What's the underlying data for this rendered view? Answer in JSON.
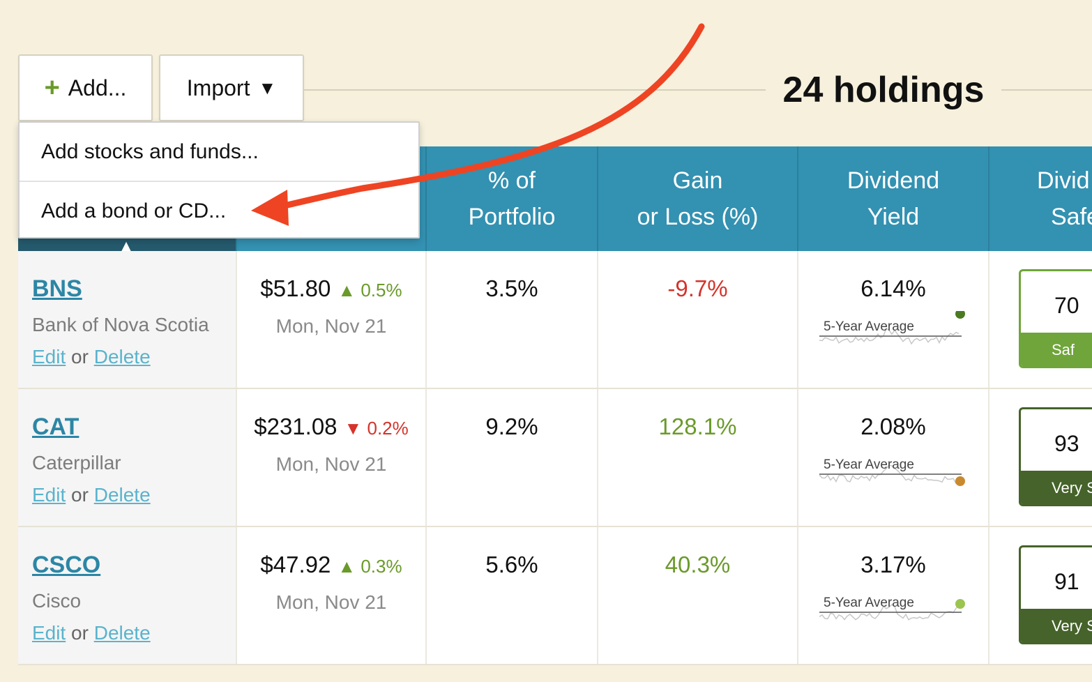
{
  "toolbar": {
    "add_icon": "plus-icon",
    "add_label": "Add...",
    "import_label": "Import",
    "import_icon": "caret-down-icon"
  },
  "holdings_title": "24 holdings",
  "add_menu": {
    "items": [
      {
        "label": "Add stocks and funds..."
      },
      {
        "label": "Add a bond or CD..."
      }
    ]
  },
  "table": {
    "headers": [
      {
        "line1": "",
        "line2": ""
      },
      {
        "line1": "",
        "line2": ""
      },
      {
        "line1": "% of",
        "line2": "Portfolio"
      },
      {
        "line1": "Gain",
        "line2": "or Loss (%)"
      },
      {
        "line1": "Dividend",
        "line2": "Yield"
      },
      {
        "line1": "Divid",
        "line2": "Safe"
      }
    ],
    "rows": [
      {
        "ticker": "BNS",
        "company": "Bank of Nova Scotia",
        "edit": "Edit",
        "or": "or",
        "delete": "Delete",
        "price": "$51.80",
        "change_dir": "up",
        "change": "0.5%",
        "date": "Mon, Nov 21",
        "pct_portfolio": "3.5%",
        "gain_loss": "-9.7%",
        "gain_dir": "neg",
        "yield": "6.14%",
        "yield_avg_label": "5-Year Average",
        "yield_dot_color": "#4a7a22",
        "safety_score": "70",
        "safety_label": "Saf",
        "safety_color": "#6fa53a"
      },
      {
        "ticker": "CAT",
        "company": "Caterpillar",
        "edit": "Edit",
        "or": "or",
        "delete": "Delete",
        "price": "$231.08",
        "change_dir": "down",
        "change": "0.2%",
        "date": "Mon, Nov 21",
        "pct_portfolio": "9.2%",
        "gain_loss": "128.1%",
        "gain_dir": "pos",
        "yield": "2.08%",
        "yield_avg_label": "5-Year Average",
        "yield_dot_color": "#c9892f",
        "safety_score": "93",
        "safety_label": "Very S",
        "safety_color": "#45632a"
      },
      {
        "ticker": "CSCO",
        "company": "Cisco",
        "edit": "Edit",
        "or": "or",
        "delete": "Delete",
        "price": "$47.92",
        "change_dir": "up",
        "change": "0.3%",
        "date": "Mon, Nov 21",
        "pct_portfolio": "5.6%",
        "gain_loss": "40.3%",
        "gain_dir": "pos",
        "yield": "3.17%",
        "yield_avg_label": "5-Year Average",
        "yield_dot_color": "#9bc54e",
        "safety_score": "91",
        "safety_label": "Very S",
        "safety_color": "#45632a"
      }
    ]
  },
  "annotation_arrow_color": "#ee4423"
}
